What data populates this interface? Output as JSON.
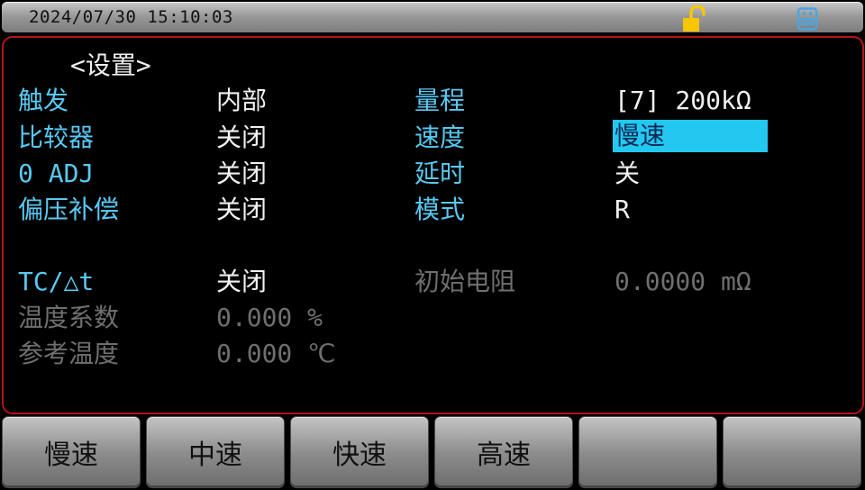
{
  "status_bar": {
    "datetime": "2024/07/30  15:10:03",
    "lock_icon": "unlocked-padlock-icon",
    "usb_icon": "usb-drive-icon",
    "lock_color": "#f7c600",
    "usb_color": "#4aa6e0"
  },
  "settings": {
    "title": "<设置>",
    "left_column": [
      {
        "label": "触发",
        "value": "内部"
      },
      {
        "label": "比较器",
        "value": "关闭"
      },
      {
        "label": "0 ADJ",
        "value": "关闭"
      },
      {
        "label": "偏压补偿",
        "value": "关闭"
      }
    ],
    "right_column": [
      {
        "label": "量程",
        "value": "[7] 200kΩ"
      },
      {
        "label": "速度",
        "value": "慢速",
        "selected": true
      },
      {
        "label": "延时",
        "value": "关"
      },
      {
        "label": "模式",
        "value": "R"
      }
    ],
    "temperature": {
      "tc_label": "TC/△t",
      "tc_value": "关闭",
      "initial_resistance_label": "初始电阻",
      "initial_resistance_value": "0.0000 mΩ",
      "coefficient_label": "温度系数",
      "coefficient_value": "0.000 %",
      "reference_temp_label": "参考温度",
      "reference_temp_value": "0.000 ℃"
    }
  },
  "softkeys": [
    "慢速",
    "中速",
    "快速",
    "高速",
    "",
    ""
  ],
  "colors": {
    "label": "#58c8f2",
    "value": "#f0f0f0",
    "disabled": "#6f6f6f",
    "highlight": "#22c8f0",
    "panel_border": "#b3141b"
  }
}
